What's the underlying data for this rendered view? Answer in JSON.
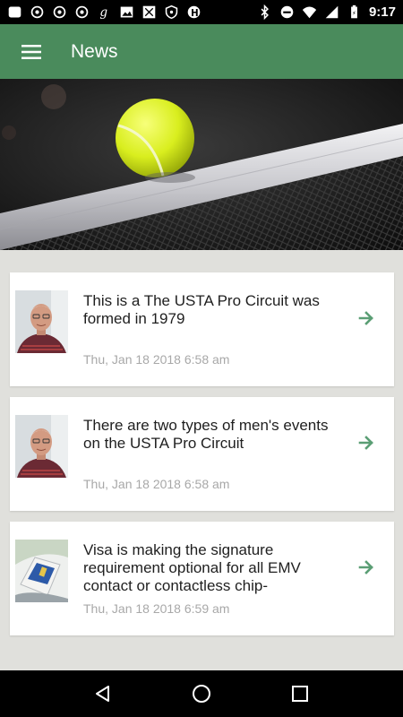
{
  "status_bar": {
    "time": "9:17",
    "left_icons": [
      "notification-icon",
      "app-icon",
      "app-icon",
      "app-icon",
      "goodreads-icon",
      "image-icon",
      "nfl-icon",
      "shield-icon",
      "app-icon"
    ],
    "right_icons": [
      "bluetooth-icon",
      "do-not-disturb-icon",
      "wifi-icon",
      "signal-icon",
      "battery-icon"
    ]
  },
  "app_bar": {
    "title": "News",
    "color": "#4a8b5c"
  },
  "news": [
    {
      "title": "This is a The USTA Pro Circuit was formed in 1979",
      "date": "Thu, Jan 18 2018 6:58 am",
      "thumb": "person-photo"
    },
    {
      "title": "There are two types of men's events on the USTA Pro Circuit",
      "date": "Thu, Jan 18 2018 6:58 am",
      "thumb": "person-photo"
    },
    {
      "title": "Visa is making the signature requirement optional for all EMV contact or contactless chip-",
      "date": "Thu, Jan 18 2018 6:59 am",
      "thumb": "card-photo"
    }
  ],
  "accent": "#5a9e74"
}
